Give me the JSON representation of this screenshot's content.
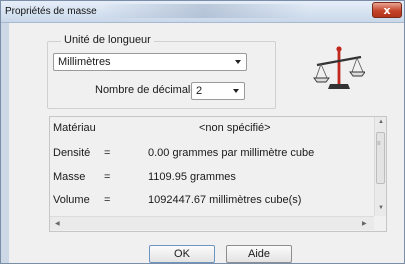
{
  "window": {
    "title": "Propriétés de masse",
    "close_symbol": "x"
  },
  "length_unit": {
    "group_label": "Unité de longueur",
    "unit_value": "Millimètres",
    "decimals_label": "Nombre de décimales:",
    "decimals_value": "2"
  },
  "properties": {
    "material_label": "Matériau",
    "material_value": "<non spécifié>",
    "rows": [
      {
        "label": "Densité",
        "sep": "=",
        "value": "0.00 grammes par millimètre cube"
      },
      {
        "label": "Masse",
        "sep": "=",
        "value": "1109.95 grammes"
      },
      {
        "label": "Volume",
        "sep": "=",
        "value": "1092447.67 millimètres cube(s)"
      }
    ]
  },
  "buttons": {
    "ok": "OK",
    "help": "Aide"
  },
  "icons": {
    "scale": "scale-balance-icon"
  },
  "colors": {
    "scale_red": "#c0281e",
    "border_blue": "#6d95bf"
  }
}
